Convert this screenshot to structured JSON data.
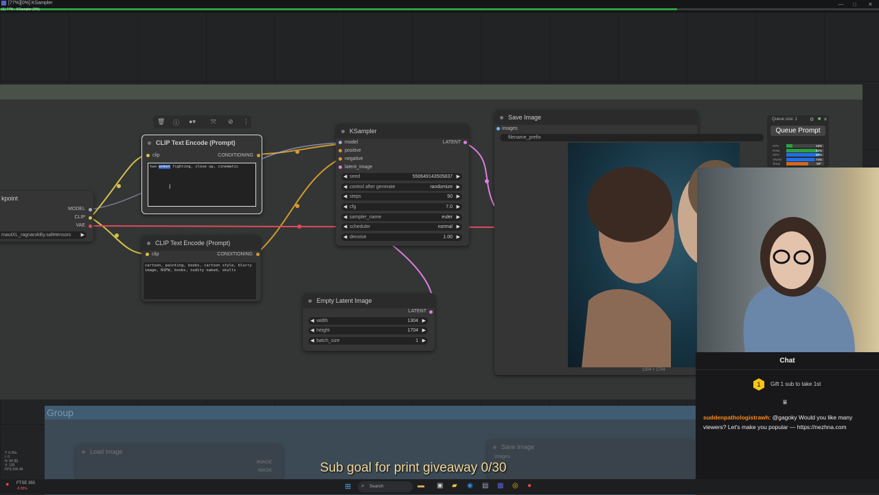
{
  "window": {
    "title": "[77%][0%] KSampler",
    "subtitle": "(1) 77% - KSampler (0%)",
    "progress_percent": 77,
    "controls": [
      "—",
      "□",
      "✕"
    ]
  },
  "toolbar": {
    "icons": [
      "trash-icon",
      "info-icon",
      "color-icon",
      "fit-icon",
      "bypass-icon",
      "more-icon"
    ],
    "glyphs": [
      "🗑",
      "ⓘ",
      "●▾",
      "⤧",
      "⊘",
      "⋮"
    ]
  },
  "checkpoint_node": {
    "title": "kpoint",
    "outputs": [
      "MODEL",
      "CLIP",
      "VAE"
    ],
    "ckpt_name": "mautXL_ragnarokBy.safetensors"
  },
  "clip_pos": {
    "title": "CLIP Text Encode (Prompt)",
    "input": "clip",
    "output": "CONDITIONING",
    "text_selected": "woman",
    "text_before": "two ",
    "text_after": " fighting, close up, cinematic"
  },
  "clip_neg": {
    "title": "CLIP Text Encode (Prompt)",
    "input": "clip",
    "output": "CONDITIONING",
    "text": "cartoon, painting, boobs, cartoon style, blurry image, NSFW, boobs, nudity naked, skulls"
  },
  "ksampler": {
    "title": "KSampler",
    "inputs": [
      "model",
      "positive",
      "negative",
      "latent_image"
    ],
    "output": "LATENT",
    "widgets": [
      {
        "label": "seed",
        "value": "550649143505837"
      },
      {
        "label": "control after generate",
        "value": "randomize"
      },
      {
        "label": "steps",
        "value": "50"
      },
      {
        "label": "cfg",
        "value": "7.0"
      },
      {
        "label": "sampler_name",
        "value": "euler"
      },
      {
        "label": "scheduler",
        "value": "normal"
      },
      {
        "label": "denoise",
        "value": "1.00"
      }
    ]
  },
  "empty_latent": {
    "title": "Empty Latent Image",
    "output": "LATENT",
    "widgets": [
      {
        "label": "width",
        "value": "1304"
      },
      {
        "label": "height",
        "value": "1704"
      },
      {
        "label": "batch_size",
        "value": "1"
      }
    ]
  },
  "save_image": {
    "title": "Save Image",
    "input": "images",
    "filename_prefix": "filename_prefix",
    "image_size": "1304 × 1704"
  },
  "queue_panel": {
    "queue_size": "Queue size: 1",
    "queue_button": "Queue Prompt",
    "stats": [
      {
        "label": "CPU",
        "value": "16%",
        "color": "#2ea043"
      },
      {
        "label": "RAM",
        "value": "82%",
        "color": "#2ea043"
      },
      {
        "label": "GPU",
        "value": "88%",
        "color": "#1f6feb"
      },
      {
        "label": "VRAM",
        "value": "74%",
        "color": "#1f6feb"
      },
      {
        "label": "Temp",
        "value": "59°",
        "color": "#d2691e"
      }
    ]
  },
  "group2": {
    "label": "Group",
    "load_image_title": "Load Image",
    "load_image_outputs": [
      "IMAGE",
      "MASK"
    ],
    "save_image_title": "Save Image",
    "save_image_input": "images"
  },
  "stats_overlay": [
    "T: 0.00s",
    "I: 0",
    "N: 84 [8]",
    "V: 135",
    "FPS:166.48"
  ],
  "chat": {
    "title": "Chat",
    "gift_badge": "1",
    "gift_text": "Gift 1 sub to take 1st",
    "messages": [
      {
        "user": "suddenpathologistrawh",
        "text": ": @gagoky Would you like many viewers? Let's make you popular — https://nezhna.com",
        "user_color": "#ff8c1a"
      }
    ]
  },
  "overlay": {
    "sub_goal": "Sub goal for print giveaway 0/30"
  },
  "taskbar": {
    "weather": "FTSE 350",
    "weather_sub": "-0.55%",
    "search_placeholder": "Search"
  }
}
